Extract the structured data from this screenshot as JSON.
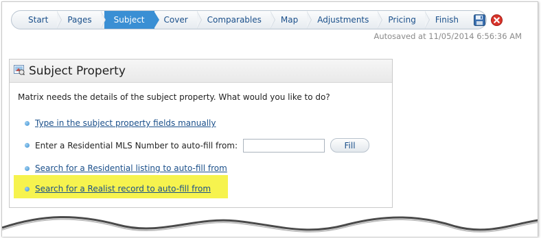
{
  "wizard": {
    "steps": [
      {
        "label": "Start"
      },
      {
        "label": "Pages"
      },
      {
        "label": "Subject"
      },
      {
        "label": "Cover"
      },
      {
        "label": "Comparables"
      },
      {
        "label": "Map"
      },
      {
        "label": "Adjustments"
      },
      {
        "label": "Pricing"
      },
      {
        "label": "Finish"
      }
    ],
    "active_index": 2,
    "autosave_text": "Autosaved at 11/05/2014 6:56:36 AM"
  },
  "icons": {
    "save": "save-icon",
    "close": "close-icon",
    "panel": "subject-property-icon",
    "bullet": "bullet-icon"
  },
  "colors": {
    "accent": "#3a8fd4",
    "link": "#1a4f8a",
    "close_red": "#d9342b",
    "highlight": "#f6f34e"
  },
  "panel": {
    "title": "Subject Property",
    "intro": "Matrix needs the details of the subject property. What would you like to do?",
    "options": {
      "manual": "Type in the subject property fields manually",
      "mls_label": "Enter a Residential MLS Number to auto-fill from:",
      "mls_value": "",
      "fill_button": "Fill",
      "residential_search": "Search for a Residential listing to auto-fill from",
      "realist_search": "Search for a Realist record to auto-fill from"
    }
  }
}
